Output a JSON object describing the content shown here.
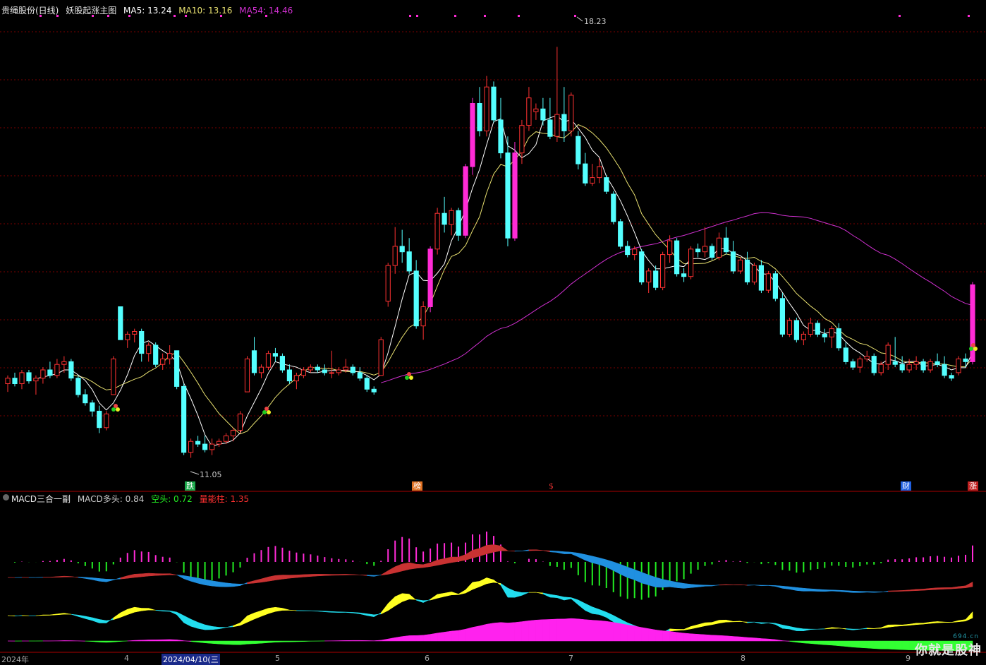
{
  "header": {
    "stock_name": "贵绳股份(日线)",
    "indicator_name": "妖股起涨主图",
    "ma5_label": "MA5: 13.24",
    "ma10_label": "MA10: 13.16",
    "ma54_label": "MA54: 14.46"
  },
  "sub_header": {
    "name": "MACD三合一副",
    "bull_label": "MACD多头: 0.84",
    "bear_label": "空头: 0.72",
    "energy_label": "量能柱: 1.35"
  },
  "annotations": {
    "high": "18.23",
    "low": "11.05"
  },
  "markers": [
    {
      "text": "跌",
      "color": "#1aa84a"
    },
    {
      "text": "榜",
      "color": "#e07020"
    },
    {
      "text": "$",
      "color": "#e03030"
    },
    {
      "text": "财",
      "color": "#2060e0"
    },
    {
      "text": "涨",
      "color": "#e03030"
    }
  ],
  "date_labels": [
    "2024年",
    "4",
    "2024/04/10(三",
    "5",
    "6",
    "7",
    "8",
    "9"
  ],
  "watermark": {
    "text": "你就是股神",
    "site": "694.cn"
  },
  "colors": {
    "up": "#ff3232",
    "down": "#54ffff",
    "magenta": "#ff2bd6",
    "ma5": "#ffffff",
    "ma10": "#e8e070",
    "ma54": "#d030d0",
    "grid": "#7a0000"
  },
  "chart_data": {
    "type": "candlestick",
    "title": "贵绳股份(日线)",
    "ylim": [
      10.5,
      18.8
    ],
    "ohlc": [
      [
        12.1,
        12.25,
        11.95,
        12.2
      ],
      [
        12.2,
        12.3,
        12.05,
        12.1
      ],
      [
        12.1,
        12.35,
        12.0,
        12.3
      ],
      [
        12.3,
        12.35,
        12.1,
        12.15
      ],
      [
        12.15,
        12.25,
        11.9,
        12.2
      ],
      [
        12.2,
        12.4,
        12.1,
        12.35
      ],
      [
        12.35,
        12.5,
        12.2,
        12.25
      ],
      [
        12.25,
        12.55,
        12.2,
        12.45
      ],
      [
        12.45,
        12.6,
        12.3,
        12.5
      ],
      [
        12.5,
        12.55,
        12.15,
        12.2
      ],
      [
        12.2,
        12.25,
        11.85,
        11.9
      ],
      [
        11.9,
        12.0,
        11.7,
        11.75
      ],
      [
        11.75,
        11.8,
        11.5,
        11.6
      ],
      [
        11.6,
        11.7,
        11.2,
        11.3
      ],
      [
        11.3,
        11.6,
        11.25,
        11.55
      ],
      [
        11.9,
        12.6,
        11.9,
        12.55
      ],
      [
        13.5,
        13.5,
        12.9,
        12.9
      ],
      [
        12.9,
        13.05,
        12.75,
        13.0
      ],
      [
        13.0,
        13.1,
        12.85,
        13.05
      ],
      [
        13.05,
        13.1,
        12.5,
        12.65
      ],
      [
        12.65,
        12.85,
        12.5,
        12.8
      ],
      [
        12.8,
        12.85,
        12.4,
        12.45
      ],
      [
        12.45,
        12.65,
        12.35,
        12.55
      ],
      [
        12.55,
        12.8,
        12.45,
        12.65
      ],
      [
        12.7,
        12.7,
        12.0,
        12.05
      ],
      [
        12.05,
        12.1,
        10.8,
        10.85
      ],
      [
        10.85,
        11.1,
        10.75,
        11.05
      ],
      [
        11.05,
        11.15,
        10.95,
        11.0
      ],
      [
        11.0,
        11.15,
        10.85,
        10.9
      ],
      [
        10.9,
        11.1,
        10.8,
        11.0
      ],
      [
        11.0,
        11.1,
        10.95,
        11.05
      ],
      [
        11.05,
        11.2,
        11.0,
        11.15
      ],
      [
        11.15,
        11.3,
        11.05,
        11.25
      ],
      [
        11.25,
        11.6,
        11.2,
        11.55
      ],
      [
        11.95,
        12.6,
        11.95,
        12.55
      ],
      [
        12.7,
        12.95,
        12.25,
        12.3
      ],
      [
        12.3,
        12.45,
        12.2,
        12.4
      ],
      [
        12.4,
        12.7,
        12.35,
        12.65
      ],
      [
        12.65,
        12.75,
        12.5,
        12.6
      ],
      [
        12.6,
        12.65,
        12.3,
        12.35
      ],
      [
        12.35,
        12.45,
        12.1,
        12.15
      ],
      [
        12.15,
        12.3,
        12.0,
        12.25
      ],
      [
        12.25,
        12.4,
        12.2,
        12.35
      ],
      [
        12.35,
        12.45,
        12.3,
        12.4
      ],
      [
        12.4,
        12.45,
        12.3,
        12.35
      ],
      [
        12.35,
        12.45,
        12.25,
        12.3
      ],
      [
        12.3,
        12.7,
        12.2,
        12.3
      ],
      [
        12.3,
        12.4,
        12.25,
        12.35
      ],
      [
        12.35,
        12.55,
        12.3,
        12.4
      ],
      [
        12.4,
        12.45,
        12.25,
        12.3
      ],
      [
        12.3,
        12.4,
        12.15,
        12.2
      ],
      [
        12.2,
        12.25,
        11.95,
        12.0
      ],
      [
        12.0,
        12.05,
        11.9,
        11.95
      ],
      [
        12.25,
        12.95,
        12.25,
        12.9
      ],
      [
        13.6,
        14.3,
        13.5,
        14.25
      ],
      [
        14.25,
        14.95,
        14.1,
        14.6
      ],
      [
        14.6,
        14.9,
        14.3,
        14.5
      ],
      [
        14.5,
        14.75,
        14.1,
        14.15
      ],
      [
        14.15,
        14.35,
        13.1,
        13.15
      ],
      [
        13.15,
        13.6,
        12.9,
        13.5
      ],
      [
        13.5,
        14.6,
        13.4,
        14.55
      ],
      [
        14.55,
        15.3,
        14.45,
        15.2
      ],
      [
        15.2,
        15.5,
        14.85,
        15.0
      ],
      [
        15.0,
        15.3,
        14.8,
        15.25
      ],
      [
        15.25,
        15.3,
        14.7,
        14.8
      ],
      [
        14.8,
        16.1,
        14.75,
        16.05
      ],
      [
        16.05,
        17.3,
        15.9,
        17.2
      ],
      [
        17.2,
        17.5,
        16.6,
        16.7
      ],
      [
        16.7,
        17.7,
        16.6,
        17.5
      ],
      [
        17.5,
        17.6,
        16.85,
        16.9
      ],
      [
        16.9,
        17.3,
        16.2,
        16.3
      ],
      [
        16.3,
        16.6,
        14.6,
        14.75
      ],
      [
        14.75,
        16.5,
        14.7,
        16.3
      ],
      [
        16.3,
        16.9,
        16.1,
        16.8
      ],
      [
        16.8,
        17.5,
        16.7,
        17.3
      ],
      [
        17.05,
        17.2,
        16.9,
        17.1
      ],
      [
        17.1,
        17.3,
        16.8,
        16.9
      ],
      [
        16.9,
        17.3,
        16.55,
        16.6
      ],
      [
        16.6,
        18.23,
        16.5,
        17.0
      ],
      [
        17.0,
        17.5,
        16.5,
        16.7
      ],
      [
        16.7,
        17.4,
        16.6,
        17.35
      ],
      [
        16.6,
        16.7,
        16.0,
        16.1
      ],
      [
        16.1,
        16.3,
        15.7,
        15.75
      ],
      [
        15.75,
        16.1,
        15.7,
        15.85
      ],
      [
        15.85,
        16.2,
        15.75,
        16.05
      ],
      [
        15.85,
        15.9,
        15.55,
        15.6
      ],
      [
        15.55,
        15.6,
        15.0,
        15.05
      ],
      [
        15.05,
        15.1,
        14.55,
        14.6
      ],
      [
        14.6,
        14.7,
        14.4,
        14.45
      ],
      [
        14.45,
        14.6,
        14.35,
        14.55
      ],
      [
        14.5,
        14.55,
        13.9,
        13.95
      ],
      [
        13.95,
        14.2,
        13.75,
        14.15
      ],
      [
        14.15,
        14.25,
        13.8,
        13.85
      ],
      [
        13.85,
        14.5,
        13.8,
        14.45
      ],
      [
        14.45,
        14.8,
        14.3,
        14.7
      ],
      [
        14.7,
        14.75,
        14.05,
        14.1
      ],
      [
        14.1,
        14.2,
        13.95,
        14.05
      ],
      [
        14.05,
        14.6,
        14.0,
        14.55
      ],
      [
        14.55,
        14.65,
        14.4,
        14.5
      ],
      [
        14.5,
        14.95,
        14.4,
        14.6
      ],
      [
        14.6,
        14.65,
        14.35,
        14.4
      ],
      [
        14.4,
        14.85,
        14.35,
        14.75
      ],
      [
        14.75,
        14.95,
        14.45,
        14.5
      ],
      [
        14.5,
        14.7,
        14.1,
        14.15
      ],
      [
        14.15,
        14.4,
        14.1,
        14.35
      ],
      [
        14.35,
        14.5,
        13.9,
        13.95
      ],
      [
        13.95,
        14.3,
        13.9,
        14.25
      ],
      [
        14.25,
        14.35,
        13.75,
        13.8
      ],
      [
        13.8,
        14.15,
        13.75,
        14.1
      ],
      [
        14.1,
        14.15,
        13.6,
        13.65
      ],
      [
        13.65,
        13.75,
        12.95,
        13.0
      ],
      [
        13.0,
        13.3,
        12.95,
        13.25
      ],
      [
        13.25,
        13.3,
        12.85,
        12.9
      ],
      [
        12.9,
        13.05,
        12.8,
        13.0
      ],
      [
        13.0,
        13.3,
        12.95,
        13.2
      ],
      [
        13.2,
        13.25,
        12.95,
        13.0
      ],
      [
        13.0,
        13.1,
        12.85,
        12.95
      ],
      [
        12.95,
        13.15,
        12.75,
        13.1
      ],
      [
        13.1,
        13.2,
        12.7,
        12.75
      ],
      [
        12.75,
        12.85,
        12.45,
        12.5
      ],
      [
        12.5,
        12.55,
        12.35,
        12.4
      ],
      [
        12.4,
        12.6,
        12.3,
        12.55
      ],
      [
        12.55,
        12.7,
        12.5,
        12.6
      ],
      [
        12.6,
        12.65,
        12.25,
        12.3
      ],
      [
        12.3,
        12.5,
        12.25,
        12.45
      ],
      [
        12.45,
        12.85,
        12.35,
        12.8
      ],
      [
        12.5,
        12.95,
        12.4,
        12.45
      ],
      [
        12.45,
        12.6,
        12.3,
        12.35
      ],
      [
        12.35,
        12.55,
        12.3,
        12.45
      ],
      [
        12.45,
        12.6,
        12.35,
        12.5
      ],
      [
        12.5,
        12.55,
        12.3,
        12.35
      ],
      [
        12.35,
        12.55,
        12.3,
        12.5
      ],
      [
        12.5,
        12.65,
        12.4,
        12.45
      ],
      [
        12.45,
        12.6,
        12.2,
        12.25
      ],
      [
        12.25,
        12.3,
        12.15,
        12.2
      ],
      [
        12.3,
        12.6,
        12.25,
        12.55
      ],
      [
        12.55,
        12.65,
        12.4,
        12.5
      ],
      [
        12.5,
        13.95,
        12.45,
        13.9
      ]
    ],
    "xlabel": "",
    "ylabel": ""
  }
}
